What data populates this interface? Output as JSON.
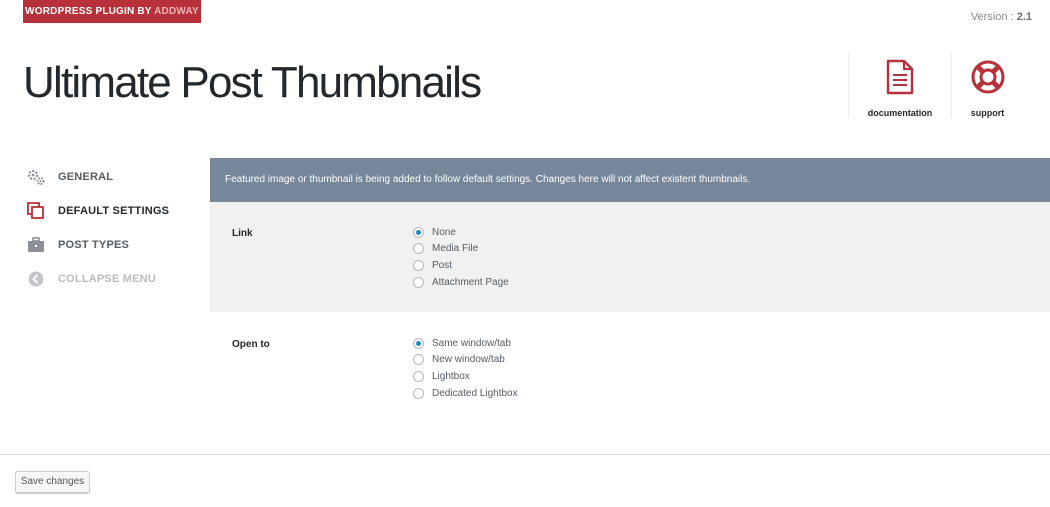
{
  "header": {
    "badge_prefix": "WORDPRESS PLUGIN BY",
    "badge_brand": "ADDWAY",
    "version_label": "Version :",
    "version_number": "2.1",
    "title": "Ultimate Post Thumbnails",
    "links": [
      {
        "label": "documentation",
        "icon": "document-icon"
      },
      {
        "label": "support",
        "icon": "lifebuoy-icon"
      }
    ]
  },
  "sidebar": {
    "items": [
      {
        "label": "GENERAL",
        "icon": "gears-icon",
        "state": "normal"
      },
      {
        "label": "DEFAULT SETTINGS",
        "icon": "copy-icon",
        "state": "active"
      },
      {
        "label": "POST TYPES",
        "icon": "briefcase-icon",
        "state": "normal"
      },
      {
        "label": "COLLAPSE MENU",
        "icon": "collapse-arrow-icon",
        "state": "muted"
      }
    ]
  },
  "main": {
    "notice": "Featured image or thumbnail is being added to follow default settings. Changes here will not affect existent thumbnails.",
    "link_setting": {
      "label": "Link",
      "options": [
        "None",
        "Media File",
        "Post",
        "Attachment Page"
      ],
      "selected": "None"
    },
    "open_setting": {
      "label": "Open to",
      "options": [
        "Same window/tab",
        "New window/tab",
        "Lightbox",
        "Dedicated Lightbox"
      ],
      "selected": "Same window/tab"
    }
  },
  "footer": {
    "save_label": "Save changes"
  },
  "colors": {
    "brand_red": "#b8313a",
    "notice_bg": "#76879a",
    "radio_selected": "#1e8cbe"
  }
}
